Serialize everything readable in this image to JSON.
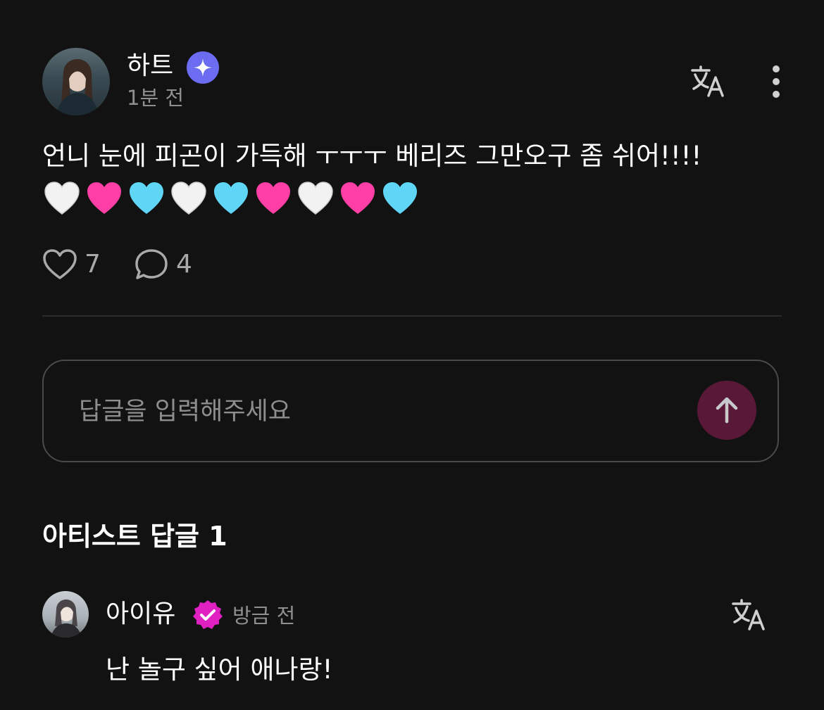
{
  "post": {
    "author": "하트",
    "time": "1분 전",
    "text": "언니 눈에 피곤이 가득해 ㅜㅜㅜ 베리즈 그만오구 좀 쉬어!!!!",
    "hearts": [
      "white",
      "pink",
      "blue",
      "white",
      "blue",
      "pink",
      "white",
      "pink",
      "blue"
    ],
    "likes": "7",
    "comments": "4"
  },
  "reply": {
    "placeholder": "답글을 입력해주세요"
  },
  "artist_replies": {
    "title": "아티스트 답글 1",
    "items": [
      {
        "name": "아이유",
        "time": "방금 전",
        "text": "난 놀구 싶어 애나랑!"
      }
    ]
  },
  "icons": {
    "author_badge": "sparkle-badge-icon",
    "artist_badge": "verified-badge-icon",
    "translate": "translate-icon",
    "more": "more-vertical-icon",
    "like": "heart-outline-icon",
    "comment": "comment-bubble-icon",
    "send": "arrow-up-icon"
  },
  "colors": {
    "background": "#121212",
    "author_badge": "#6c6cf2",
    "artist_badge": "#e020c0",
    "send_button": "#5a1838",
    "heart_white": "#f2f2f2",
    "heart_pink": "#ff3fa6",
    "heart_blue": "#5fd6f5"
  }
}
